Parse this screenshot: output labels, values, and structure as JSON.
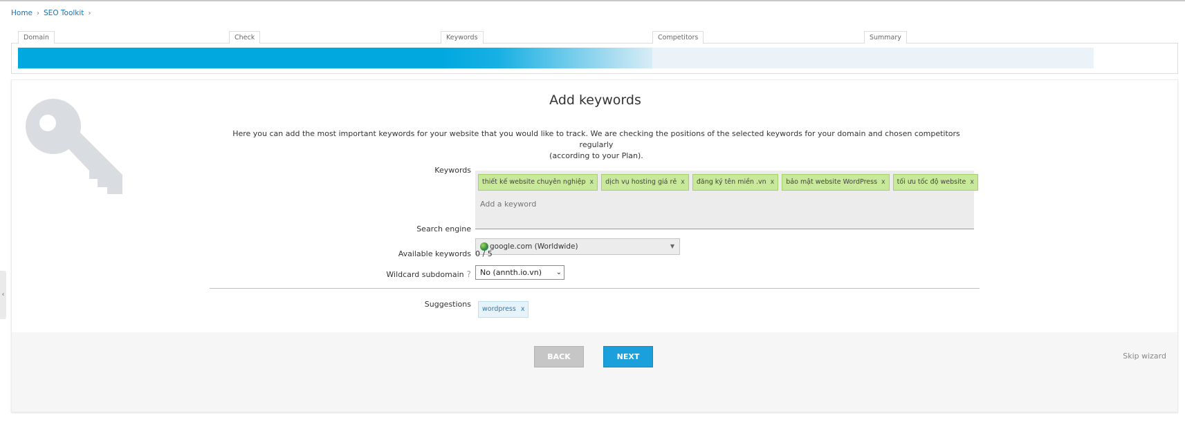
{
  "breadcrumb": {
    "home": "Home",
    "toolkit": "SEO Toolkit"
  },
  "wizard": {
    "steps": [
      {
        "label": "Domain",
        "progress": 1.0
      },
      {
        "label": "Check",
        "progress": 1.0
      },
      {
        "label": "Keywords",
        "progress": 0.5
      },
      {
        "label": "Competitors",
        "progress": 0.0
      },
      {
        "label": "Summary",
        "progress": 0.0
      }
    ]
  },
  "page": {
    "title": "Add keywords",
    "intro_line1": "Here you can add the most important keywords for your website that you would like to track. We are checking the positions of the selected keywords for your domain and chosen competitors regularly",
    "intro_line2": "(according to your Plan)."
  },
  "form": {
    "keywords_label": "Keywords",
    "keywords": [
      "thiết kế website chuyên nghiệp",
      "dịch vụ hosting giá rẻ",
      "đăng ký tên miền .vn",
      "bảo mật website WordPress",
      "tối ưu tốc độ website"
    ],
    "remove_symbol": "x",
    "add_placeholder": "Add a keyword",
    "engine_label": "Search engine",
    "engine_value": "google.com (Worldwide)",
    "available_label": "Available keywords",
    "available_value": "0 / 5",
    "wildcard_label": "Wildcard subdomain",
    "wildcard_help": "?",
    "wildcard_value": "No (annth.io.vn)",
    "suggestions_label": "Suggestions",
    "suggestions": [
      "wordpress"
    ]
  },
  "footer": {
    "back": "BACK",
    "next": "NEXT",
    "skip": "Skip wizard"
  },
  "side_handle": "‹",
  "colors": {
    "accent": "#00a8e0",
    "tag_green": "#c8e89a",
    "next_button": "#1ba0dc"
  }
}
